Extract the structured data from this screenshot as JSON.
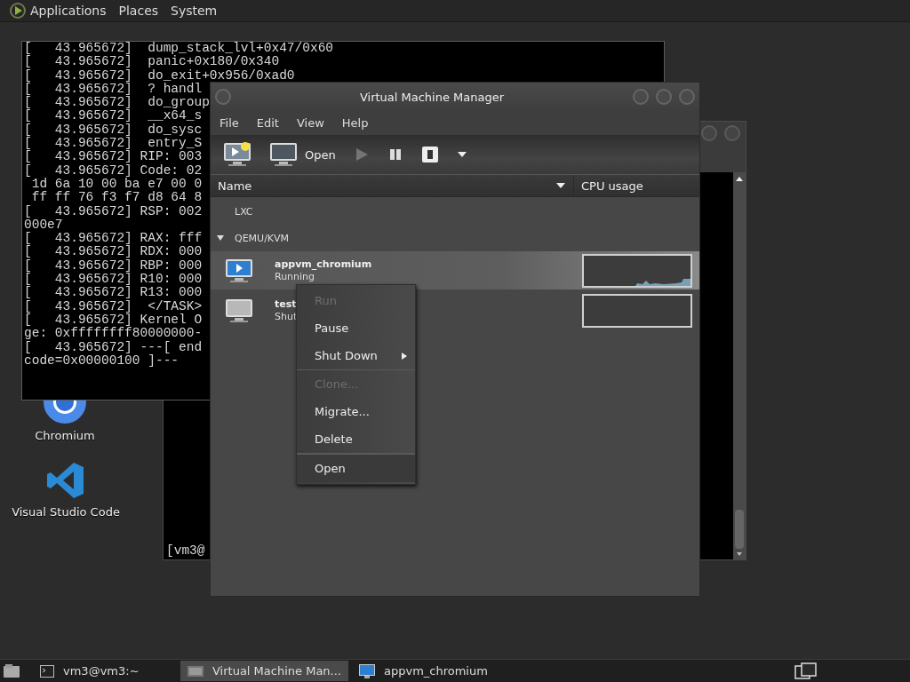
{
  "top_panel": {
    "menus": [
      "Applications",
      "Places",
      "System"
    ]
  },
  "desktop_icons": [
    {
      "label": "Chromium",
      "kind": "chromium"
    },
    {
      "label": "Visual Studio Code",
      "kind": "vscode"
    }
  ],
  "console_window": {
    "lines": [
      "[   43.965672]  dump_stack_lvl+0x47/0x60",
      "[   43.965672]  panic+0x180/0x340",
      "[   43.965672]  do_exit+0x956/0xad0",
      "[   43.965672]  ? handl",
      "[   43.965672]  do_group",
      "[   43.965672]  __x64_s",
      "[   43.965672]  do_sysc",
      "[   43.965672]  entry_S",
      "[   43.965672] RIP: 003",
      "[   43.965672] Code: 02",
      " 1d 6a 10 00 ba e7 00 0",
      " ff ff 76 f3 f7 d8 64 8",
      "[   43.965672] RSP: 002",
      "000e7",
      "[   43.965672] RAX: fff",
      "[   43.965672] RDX: 000",
      "[   43.965672] RBP: 000",
      "[   43.965672] R10: 000",
      "[   43.965672] R13: 000",
      "[   43.965672]  </TASK>",
      "[   43.965672] Kernel O",
      "ge: 0xffffffff80000000-",
      "[   43.965672] ---[ end",
      "code=0x00000100 ]---"
    ]
  },
  "terminal_window": {
    "prompt": "[vm3@"
  },
  "vmm_window": {
    "title": "Virtual Machine Manager",
    "menu": [
      "File",
      "Edit",
      "View",
      "Help"
    ],
    "toolbar": [
      {
        "kind": "new",
        "disabled": false
      },
      {
        "kind": "open",
        "label": "Open",
        "disabled": false
      },
      {
        "kind": "run",
        "disabled": true
      },
      {
        "kind": "pause",
        "disabled": false
      },
      {
        "kind": "shutdown",
        "disabled": false
      },
      {
        "kind": "dropdown",
        "disabled": false
      }
    ],
    "columns": [
      {
        "label": "Name",
        "sorted": true
      },
      {
        "label": "CPU usage",
        "sorted": false
      }
    ],
    "connections": [
      {
        "label": "LXC"
      },
      {
        "label": "QEMU/KVM",
        "expanded": true,
        "children": [
          {
            "name": "appvm_chromium",
            "status": "Running",
            "kind": "running",
            "selected": true
          },
          {
            "name": "test",
            "status": "Shut",
            "kind": "shutoff",
            "selected": false
          }
        ]
      }
    ]
  },
  "context_menu": [
    {
      "kind": "item",
      "label": "Run",
      "disabled": true,
      "submenu": false,
      "selected": false
    },
    {
      "kind": "item",
      "label": "Pause",
      "disabled": false,
      "submenu": false,
      "selected": false
    },
    {
      "kind": "item",
      "label": "Shut Down",
      "disabled": false,
      "submenu": true,
      "selected": false
    },
    {
      "kind": "separator"
    },
    {
      "kind": "item",
      "label": "Clone...",
      "disabled": true,
      "submenu": false,
      "selected": false
    },
    {
      "kind": "item",
      "label": "Migrate...",
      "disabled": false,
      "submenu": false,
      "selected": false
    },
    {
      "kind": "item",
      "label": "Delete",
      "disabled": false,
      "submenu": false,
      "selected": false
    },
    {
      "kind": "separator"
    },
    {
      "kind": "item",
      "label": "Open",
      "disabled": false,
      "submenu": false,
      "selected": true
    }
  ],
  "taskbar": [
    {
      "label": "vm3@vm3:~",
      "kind": "terminal",
      "selected": false
    },
    {
      "label": "Virtual Machine Man...",
      "kind": "vmm",
      "selected": true
    },
    {
      "label": "appvm_chromium",
      "kind": "vm",
      "selected": false
    }
  ]
}
